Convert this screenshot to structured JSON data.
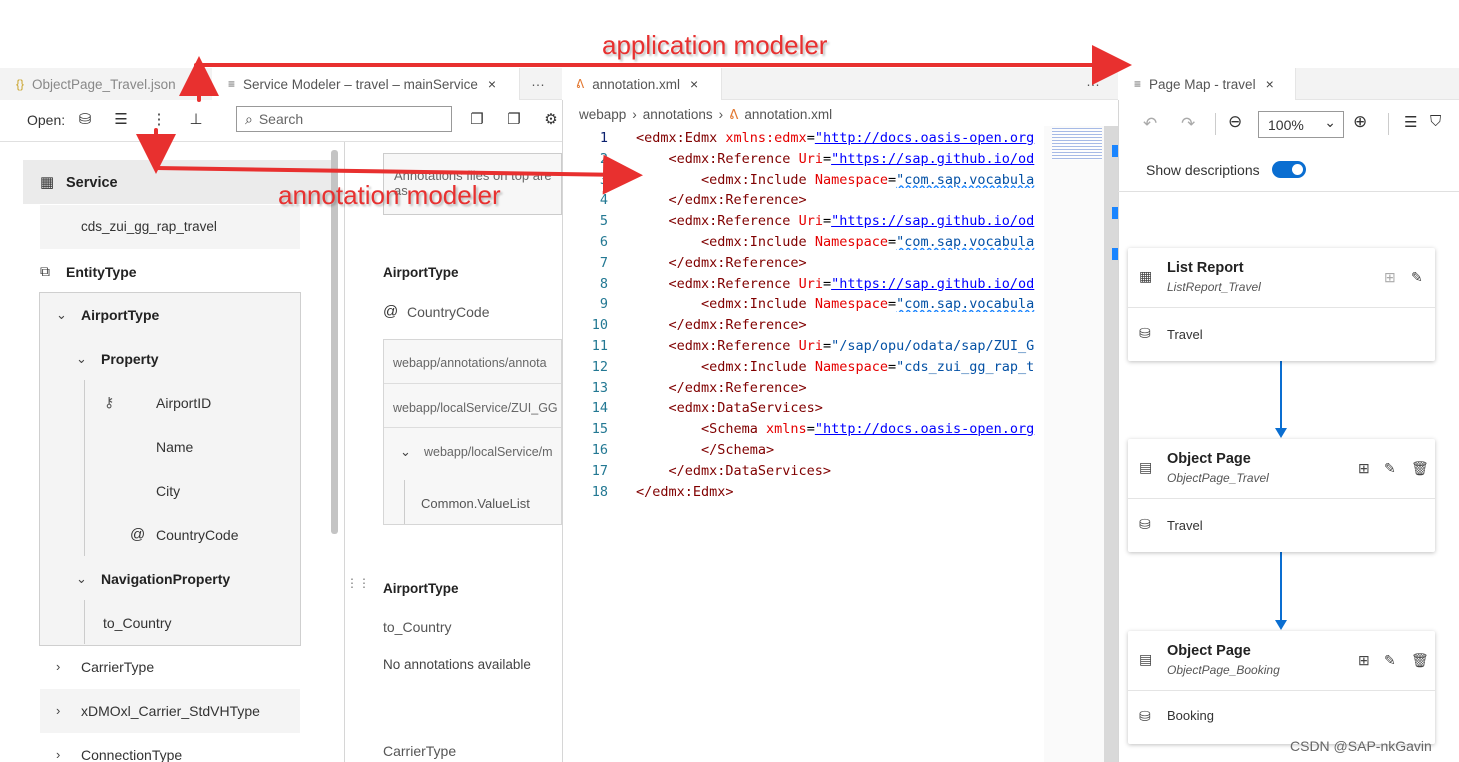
{
  "tabs": {
    "tab1": "ObjectPage_Travel.json",
    "tab2": "Service Modeler – travel – mainService",
    "tab3": "annotation.xml",
    "tab4": "Page Map - travel",
    "more": "···",
    "close": "×"
  },
  "service_modeler": {
    "open_label": "Open:",
    "search_placeholder": "Search",
    "service_heading": "Service",
    "service_name": "cds_zui_gg_rap_travel",
    "entity_type_heading": "EntityType",
    "airport_type": "AirportType",
    "property": "Property",
    "properties": [
      "AirportID",
      "Name",
      "City",
      "CountryCode"
    ],
    "navigation_property": "NavigationProperty",
    "nav_items": [
      "to_Country"
    ],
    "other_types": [
      "CarrierType",
      "xDMOxl_Carrier_StdVHType",
      "ConnectionType"
    ]
  },
  "annotation_panel": {
    "info_text": "Annotations files on top are",
    "info_text2": "as",
    "section1_title": "AirportType",
    "at_sign": "@",
    "country_code": "CountryCode",
    "rows": [
      "webapp/annotations/annota",
      "webapp/localService/ZUI_GG",
      "webapp/localService/m",
      "Common.ValueList"
    ],
    "section2_title": "AirportType",
    "section2_item": "to_Country",
    "no_annotations": "No annotations available",
    "section3_title": "CarrierType"
  },
  "editor": {
    "breadcrumb": [
      "webapp",
      "annotations",
      "annotation.xml"
    ],
    "line_numbers": [
      "1",
      "2",
      "3",
      "4",
      "5",
      "6",
      "7",
      "8",
      "9",
      "10",
      "11",
      "12",
      "13",
      "14",
      "15",
      "16",
      "17",
      "18"
    ],
    "lines": [
      {
        "t": "<edmx:Edmx ",
        "a": "xmlns:edmx",
        "s": "\"http://docs.oasis-open.org"
      },
      {
        "t": "    <edmx:Reference ",
        "a": "Uri",
        "s": "\"https://sap.github.io/od"
      },
      {
        "t": "        <edmx:Include ",
        "a": "Namespace",
        "s": "\"com.sap.vocabula"
      },
      {
        "t": "    </edmx:Reference>",
        "a": "",
        "s": ""
      },
      {
        "t": "    <edmx:Reference ",
        "a": "Uri",
        "s": "\"https://sap.github.io/od"
      },
      {
        "t": "        <edmx:Include ",
        "a": "Namespace",
        "s": "\"com.sap.vocabula"
      },
      {
        "t": "    </edmx:Reference>",
        "a": "",
        "s": ""
      },
      {
        "t": "    <edmx:Reference ",
        "a": "Uri",
        "s": "\"https://sap.github.io/od"
      },
      {
        "t": "        <edmx:Include ",
        "a": "Namespace",
        "s": "\"com.sap.vocabula"
      },
      {
        "t": "    </edmx:Reference>",
        "a": "",
        "s": ""
      },
      {
        "t": "    <edmx:Reference ",
        "a": "Uri",
        "s": "\"/sap/opu/odata/sap/ZUI_G"
      },
      {
        "t": "        <edmx:Include ",
        "a": "Namespace",
        "s": "\"cds_zui_gg_rap_t"
      },
      {
        "t": "    </edmx:Reference>",
        "a": "",
        "s": ""
      },
      {
        "t": "    <edmx:DataServices>",
        "a": "",
        "s": ""
      },
      {
        "t": "        <Schema ",
        "a": "xmlns",
        "s": "\"http://docs.oasis-open.org"
      },
      {
        "t": "        </Schema>",
        "a": "",
        "s": ""
      },
      {
        "t": "    </edmx:DataServices>",
        "a": "",
        "s": ""
      },
      {
        "t": "</edmx:Edmx>",
        "a": "",
        "s": ""
      }
    ]
  },
  "page_map": {
    "zoom": "100%",
    "show_descriptions": "Show descriptions",
    "cards": [
      {
        "title": "List Report",
        "subtitle": "ListReport_Travel",
        "entity": "Travel"
      },
      {
        "title": "Object Page",
        "subtitle": "ObjectPage_Travel",
        "entity": "Travel"
      },
      {
        "title": "Object Page",
        "subtitle": "ObjectPage_Booking",
        "entity": "Booking"
      }
    ]
  },
  "annotations_overlay": {
    "application_modeler": "application modeler",
    "annotation_modeler": "annotation modeler"
  },
  "watermark": "CSDN @SAP-nkGavin",
  "colors": {
    "accent": "#0a6ed1",
    "arrow_red": "#e8302f",
    "toggle_blue": "#0a6ed1"
  }
}
